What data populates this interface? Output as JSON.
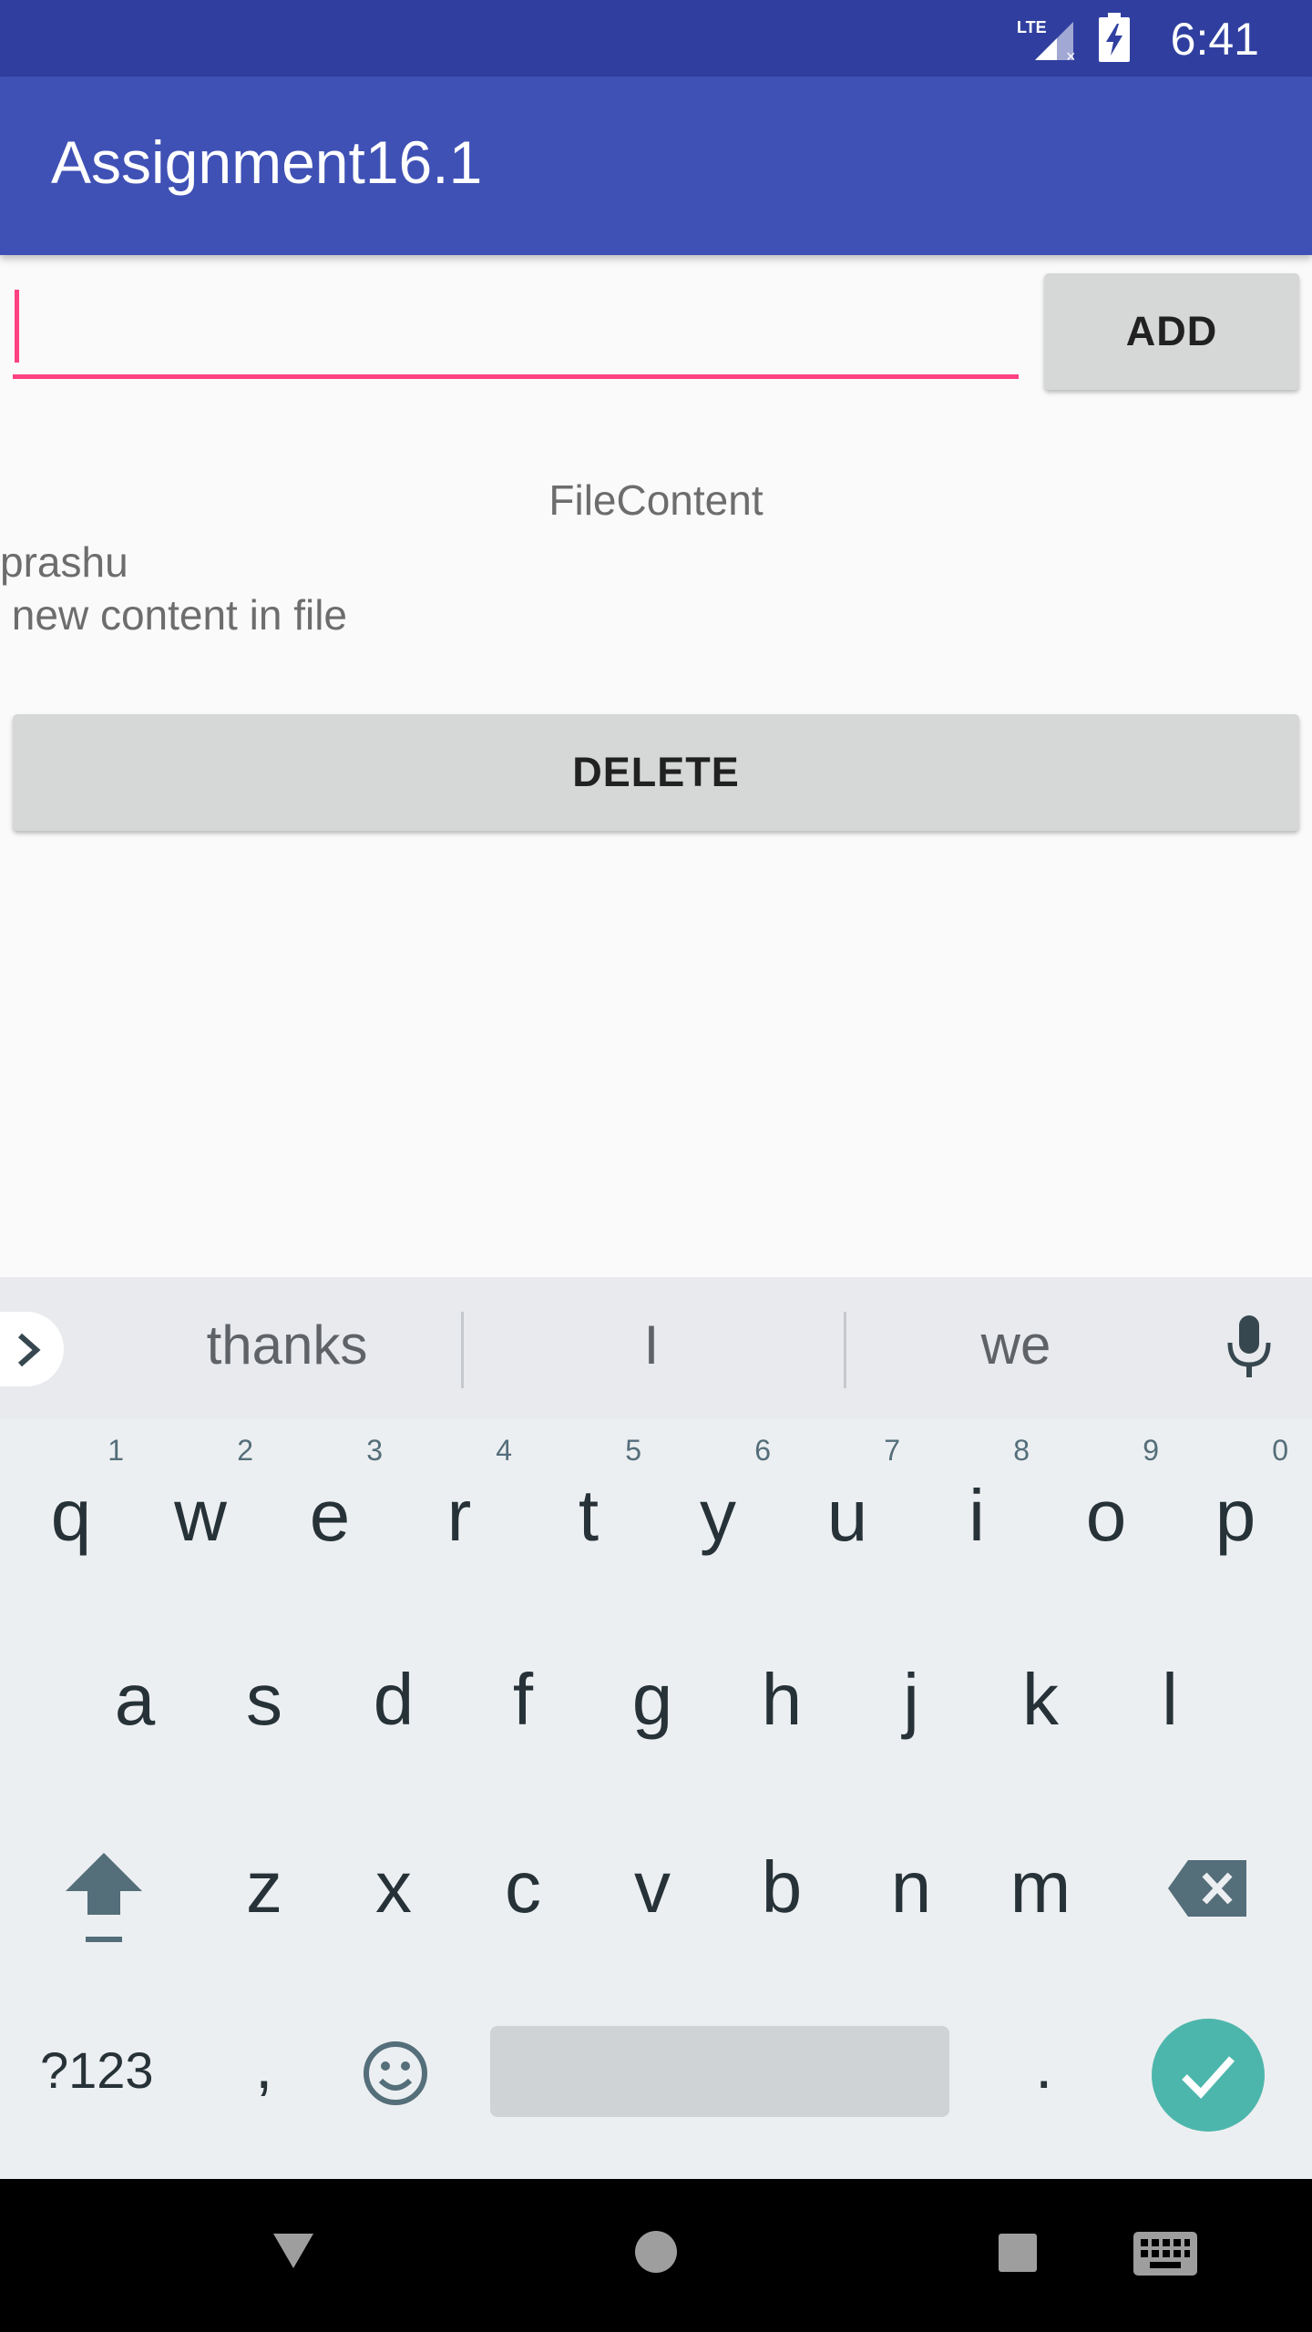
{
  "status_bar": {
    "time": "6:41",
    "network": "LTE"
  },
  "app_bar": {
    "title": "Assignment16.1"
  },
  "input": {
    "value": "",
    "placeholder": ""
  },
  "buttons": {
    "add_label": "ADD",
    "delete_label": "DELETE"
  },
  "file": {
    "label": "FileContent",
    "lines": "prashu\n new content in file"
  },
  "keyboard": {
    "suggestions": [
      "thanks",
      "I",
      "we"
    ],
    "row1": [
      {
        "ch": "q",
        "hint": "1"
      },
      {
        "ch": "w",
        "hint": "2"
      },
      {
        "ch": "e",
        "hint": "3"
      },
      {
        "ch": "r",
        "hint": "4"
      },
      {
        "ch": "t",
        "hint": "5"
      },
      {
        "ch": "y",
        "hint": "6"
      },
      {
        "ch": "u",
        "hint": "7"
      },
      {
        "ch": "i",
        "hint": "8"
      },
      {
        "ch": "o",
        "hint": "9"
      },
      {
        "ch": "p",
        "hint": "0"
      }
    ],
    "row2": [
      "a",
      "s",
      "d",
      "f",
      "g",
      "h",
      "j",
      "k",
      "l"
    ],
    "row3": [
      "z",
      "x",
      "c",
      "v",
      "b",
      "n",
      "m"
    ],
    "symbols_label": "?123",
    "comma": ",",
    "period": "."
  },
  "colors": {
    "primary": "#3f51b5",
    "primary_dark": "#303f9f",
    "accent": "#ff4081",
    "enter": "#4db6ac"
  },
  "icons": [
    "lte-signal-icon",
    "battery-charging-icon",
    "chevron-right-icon",
    "microphone-icon",
    "shift-icon",
    "backspace-icon",
    "emoji-icon",
    "check-icon",
    "nav-back-icon",
    "nav-home-icon",
    "nav-recents-icon",
    "keyboard-switch-icon"
  ]
}
